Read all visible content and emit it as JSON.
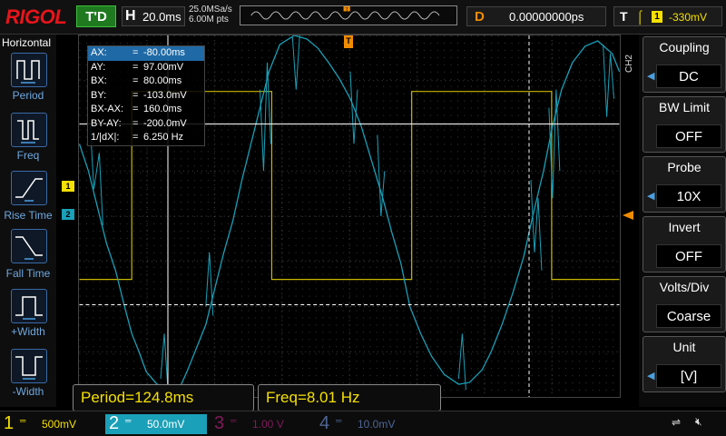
{
  "top": {
    "logo": "RIGOL",
    "trigger_state": "T'D",
    "h_label": "H",
    "timebase": "20.0ms",
    "sample_rate": "25.0MSa/s",
    "memory_depth": "6.00M pts",
    "delay_label": "D",
    "delay_value": "0.00000000ps",
    "trigger_label": "T",
    "trigger_channel": "1",
    "trigger_level": "-330mV",
    "trigger_slope_icon": "rising-edge-icon"
  },
  "left": {
    "header": "Horizontal",
    "items": [
      "Period",
      "Freq",
      "Rise Time",
      "Fall Time",
      "+Width",
      "-Width"
    ]
  },
  "right": {
    "channel_tag": "CH2",
    "tiles": [
      {
        "title": "Coupling",
        "value": "DC"
      },
      {
        "title": "BW Limit",
        "value": "OFF"
      },
      {
        "title": "Probe",
        "value": "10X"
      },
      {
        "title": "Invert",
        "value": "OFF"
      },
      {
        "title": "Volts/Div",
        "value": "Coarse"
      },
      {
        "title": "Unit",
        "value": "[V]"
      }
    ]
  },
  "cursors": {
    "rows": [
      {
        "k": "AX:",
        "v": "-80.00ms"
      },
      {
        "k": "AY:",
        "v": "97.00mV"
      },
      {
        "k": "BX:",
        "v": "80.00ms"
      },
      {
        "k": "BY:",
        "v": "-103.0mV"
      },
      {
        "k": "BX-AX:",
        "v": "160.0ms"
      },
      {
        "k": "BY-AY:",
        "v": "-200.0mV"
      },
      {
        "k": "1/|dX|:",
        "v": "6.250 Hz"
      }
    ]
  },
  "measurements": {
    "period": "Period=124.8ms",
    "freq": "Freq=8.01 Hz"
  },
  "channels": [
    {
      "num": "1",
      "coupling": "DC",
      "scale": "500mV"
    },
    {
      "num": "2",
      "coupling": "DC",
      "scale": "50.0mV"
    },
    {
      "num": "3",
      "coupling": "DC",
      "scale": "1.00 V"
    },
    {
      "num": "4",
      "coupling": "DC",
      "scale": "10.0mV"
    }
  ],
  "markers": {
    "ch1": "1",
    "ch2": "2",
    "trigger_pos": "T"
  },
  "colors": {
    "ch1": "#f5e000",
    "ch2": "#1aa0b8",
    "ch3": "#b0207a",
    "ch4": "#6a8cd0",
    "brand": "#e8141b",
    "accent": "#f08c00"
  }
}
